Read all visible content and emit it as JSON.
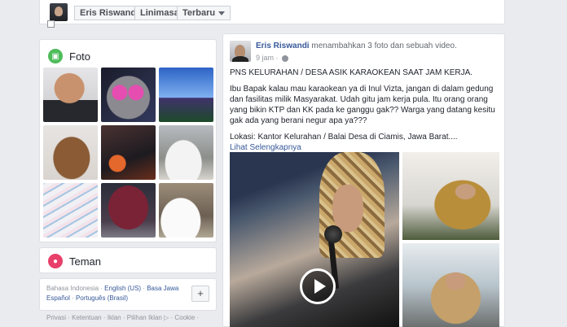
{
  "topbar": {
    "name": "Eris Riswandi",
    "view": "Linimasa",
    "sort": "Terbaru"
  },
  "photos": {
    "title": "Foto",
    "icon": "photo-icon"
  },
  "friends": {
    "title": "Teman",
    "icon": "friends-icon"
  },
  "languages": {
    "current": "Bahasa Indonesia",
    "links": [
      "English (US)",
      "Basa Jawa",
      "Español",
      "Português (Brasil)"
    ],
    "add": "+"
  },
  "footer": {
    "items": [
      "Privasi",
      "Ketentuan",
      "Iklan",
      "Pilihan Iklan",
      "Cookie"
    ]
  },
  "post": {
    "author": "Eris Riswandi",
    "action": "menambahkan 3 foto dan sebuah video.",
    "time": "9 jam",
    "title": "PNS KELURAHAN / DESA ASIK KARAOKEAN SAAT JAM KERJA.",
    "body1": "Ibu Bapak kalau mau karaokean ya di Inul Vizta, jangan di dalam gedung dan fasilitas milik Masyarakat. Udah gitu jam kerja pula. Itu orang orang yang bikin KTP dan KK pada ke ganggu gak?? Warga yang datang kesitu gak ada yang berani negur apa ya???",
    "location": "Lokasi: Kantor Kelurahan / Balai Desa di Ciamis, Jawa Barat....",
    "see_more": "Lihat Selengkapnya"
  }
}
